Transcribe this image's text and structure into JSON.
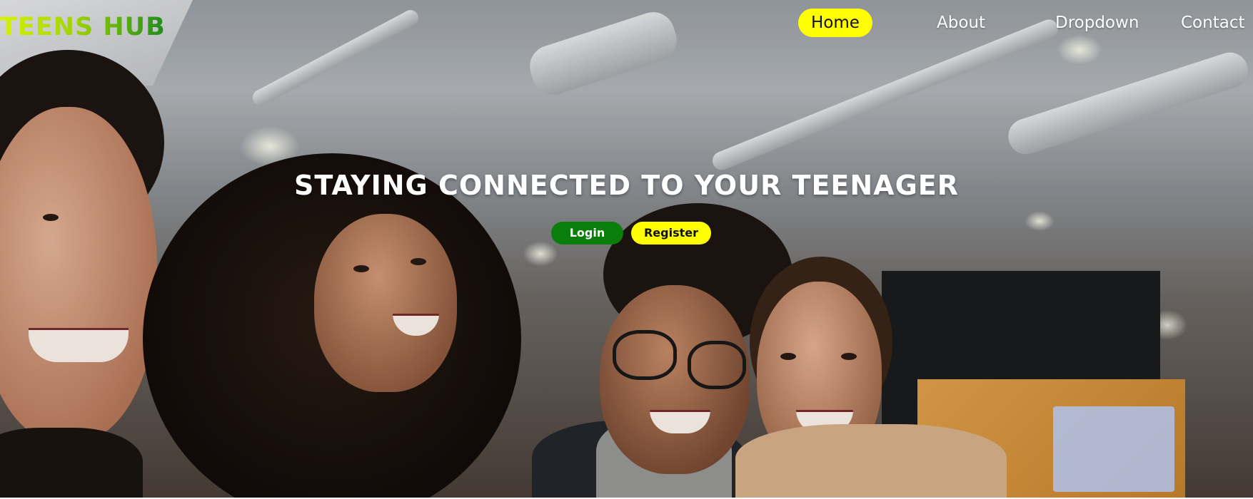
{
  "brand": {
    "name": "TEENS HUB"
  },
  "nav": {
    "items": [
      {
        "label": "Home",
        "active": true
      },
      {
        "label": "About",
        "active": false
      },
      {
        "label": "Dropdown",
        "active": false
      },
      {
        "label": "Contact",
        "active": false
      }
    ]
  },
  "hero": {
    "headline": "STAYING CONNECTED TO YOUR TEENAGER",
    "login_label": "Login",
    "register_label": "Register"
  },
  "colors": {
    "accent_yellow": "#ffff00",
    "accent_green": "#0b7d0b",
    "brand_gradient_start": "#d7f200",
    "brand_gradient_end": "#1e8c1e"
  }
}
